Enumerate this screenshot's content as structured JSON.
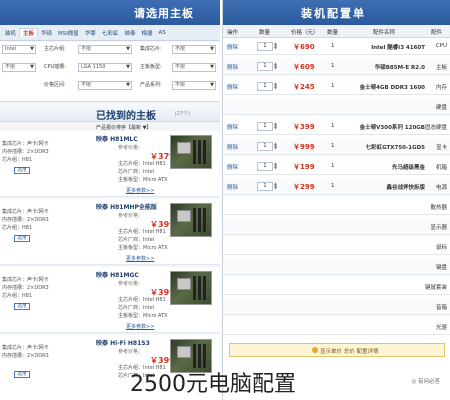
{
  "left": {
    "header_title": "请选用主板",
    "tabs": [
      "装机",
      "主板",
      "华硕",
      "MSI微星",
      "华擎",
      "七彩虹",
      "映泰",
      "梅捷",
      "AS"
    ],
    "active_tab": 1,
    "filters": {
      "r1_sel_a": "Intel",
      "r1_label_b": "主芯片组:",
      "r1_sel_b": "不限",
      "r1_label_c": "集成芯片:",
      "r1_sel_c": "不限",
      "r2_sel_a": "不限",
      "r2_label_b": "CPU插槽:",
      "r2_sel_b": "LGA 1150",
      "r2_label_c": "主板板型:",
      "r2_sel_c": "不限",
      "r3_label_b": "价格区间:",
      "r3_sel_b": "不限",
      "r3_label_c": "产品系列:",
      "r3_sel_c": "不限"
    },
    "section_title": "已找到的主板",
    "section_count": "(27个)",
    "sort_text": "产品报价排序【最新 ▼】",
    "products": [
      {
        "name": "映泰 H81MLC",
        "ref_price": "参考价格：",
        "price": "￥379",
        "spec": [
          "主芯片组：Intel H81",
          "芯片厂商：Intel",
          "主板板型：Micro ATX"
        ],
        "link": "更多参数>>",
        "left_lines": [
          "集成芯片：声卡/网卡",
          "内存插槽：2×DDR3",
          "芯片组：H81"
        ],
        "btn": "选用"
      },
      {
        "name": "映泰 H81MHP全能版",
        "ref_price": "参考价格：",
        "price": "￥399",
        "spec": [
          "主芯片组：Intel H81",
          "芯片厂商：Intel",
          "主板板型：Micro ATX"
        ],
        "link": "更多参数>>",
        "left_lines": [
          "集成芯片：声卡/网卡",
          "内存插槽：2×DDR3",
          "芯片组：H81"
        ],
        "btn": "选用"
      },
      {
        "name": "映泰 H81MGC",
        "ref_price": "参考价格：",
        "price": "￥399",
        "spec": [
          "主芯片组：Intel H81",
          "芯片厂商：Intel",
          "主板板型：Micro ATX"
        ],
        "link": "更多参数>>",
        "left_lines": [
          "集成芯片：声卡/网卡",
          "内存插槽：2×DDR3",
          "芯片组：H81"
        ],
        "btn": "选用"
      },
      {
        "name": "映泰 Hi-Fi H81S3",
        "ref_price": "参考价格：",
        "price": "￥399",
        "spec": [
          "主芯片组：Intel H81",
          "芯片厂商：Intel"
        ],
        "link": "",
        "left_lines": [
          "集成芯片：声卡/网卡",
          "内存插槽：2×DDR3"
        ],
        "btn": "选用"
      }
    ]
  },
  "right": {
    "header_title": "装机配置单",
    "columns": [
      "操作",
      "数量",
      "价格（元）",
      "数量",
      "配件名称",
      "配件"
    ],
    "rows": [
      {
        "action": "删除",
        "qty": "1",
        "price": "￥690",
        "count": "1",
        "name": "Intel 酷睿i3 4160T",
        "cat": "CPU"
      },
      {
        "action": "删除",
        "qty": "1",
        "price": "￥609",
        "count": "1",
        "name": "华硕B85M-E R2.0",
        "cat": "主板"
      },
      {
        "action": "删除",
        "qty": "1",
        "price": "￥245",
        "count": "1",
        "name": "金士顿4GB DDR3 1600",
        "cat": "内存"
      },
      {
        "action": "",
        "qty": "",
        "price": "",
        "count": "",
        "name": "",
        "cat": "硬盘"
      },
      {
        "action": "删除",
        "qty": "1",
        "price": "￥399",
        "count": "1",
        "name": "金士顿V300系列 120GB",
        "cat": "固态硬盘"
      },
      {
        "action": "删除",
        "qty": "1",
        "price": "￥999",
        "count": "1",
        "name": "七彩虹GTX750-1GD5",
        "cat": "显卡"
      },
      {
        "action": "删除",
        "qty": "1",
        "price": "￥199",
        "count": "1",
        "name": "先马超级黑金",
        "cat": "机箱"
      },
      {
        "action": "删除",
        "qty": "1",
        "price": "￥299",
        "count": "1",
        "name": "鑫谷战斧快拆版",
        "cat": "电源"
      },
      {
        "action": "",
        "qty": "",
        "price": "",
        "count": "",
        "name": "",
        "cat": "散热器"
      },
      {
        "action": "",
        "qty": "",
        "price": "",
        "count": "",
        "name": "",
        "cat": "显示器"
      },
      {
        "action": "",
        "qty": "",
        "price": "",
        "count": "",
        "name": "",
        "cat": "鼠标"
      },
      {
        "action": "",
        "qty": "",
        "price": "",
        "count": "",
        "name": "",
        "cat": "键盘"
      },
      {
        "action": "",
        "qty": "",
        "price": "",
        "count": "",
        "name": "",
        "cat": "键鼠套装"
      },
      {
        "action": "",
        "qty": "",
        "price": "",
        "count": "",
        "name": "",
        "cat": "音箱"
      },
      {
        "action": "",
        "qty": "",
        "price": "",
        "count": "",
        "name": "",
        "cat": "光驱"
      }
    ],
    "total_text": "显示单价 总价 配置详情",
    "footer_text": "◎ 有问必答"
  },
  "watermark": "2500元电脑配置"
}
